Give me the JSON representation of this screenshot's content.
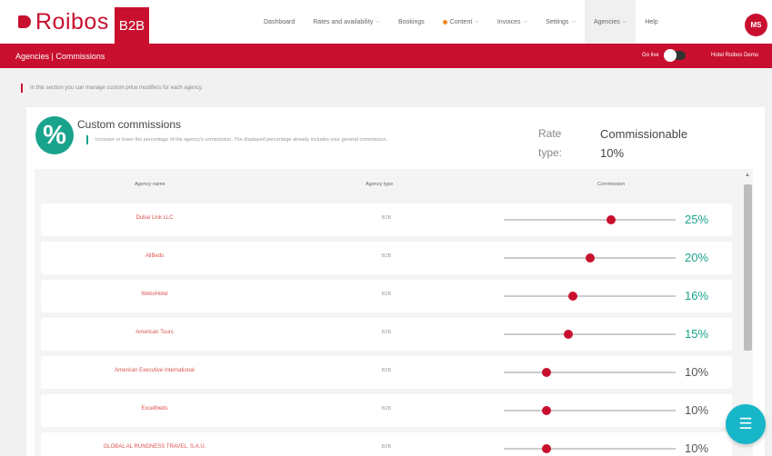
{
  "app": {
    "logo_text": "Roibos",
    "logo_badge": "B2B"
  },
  "nav": {
    "items": [
      {
        "label": "Dashboard",
        "chevron": false,
        "dot": false
      },
      {
        "label": "Rates and availability",
        "chevron": true,
        "dot": false
      },
      {
        "label": "Bookings",
        "chevron": false,
        "dot": false
      },
      {
        "label": "Content",
        "chevron": true,
        "dot": true
      },
      {
        "label": "Invoices",
        "chevron": true,
        "dot": false
      },
      {
        "label": "Settings",
        "chevron": true,
        "dot": false
      },
      {
        "label": "Agencies",
        "chevron": true,
        "dot": false,
        "active": true
      },
      {
        "label": "Help",
        "chevron": false,
        "dot": false
      }
    ],
    "avatar_initials": "MS"
  },
  "subheader": {
    "breadcrumb": "Agencies | Commissions",
    "go_live_label": "Go live",
    "hotel_label": "Hotel Roibos Demo"
  },
  "info_text": "In this section you can manage custom price modifiers for each agency.",
  "card": {
    "title": "Custom commissions",
    "description": "Increase or lower the percentage of the agency's commission. The displayed percentage already includes your general commission.",
    "rate_type_label": "Rate type:",
    "rate_type_value": "Commissionable",
    "rate_percent": "10%"
  },
  "table": {
    "headers": [
      "Agency name",
      "Agency type",
      "Commission"
    ],
    "rows": [
      {
        "name": "Dubai Link LLC",
        "type": "B2B",
        "commission": 25,
        "display": "25%",
        "highlight": true
      },
      {
        "name": "AllBeds",
        "type": "B2B",
        "commission": 20,
        "display": "20%",
        "highlight": true
      },
      {
        "name": "WebsHotel",
        "type": "B2B",
        "commission": 16,
        "display": "16%",
        "highlight": true
      },
      {
        "name": "American Tours",
        "type": "B2B",
        "commission": 15,
        "display": "15%",
        "highlight": true
      },
      {
        "name": "American Executive International",
        "type": "B2B",
        "commission": 10,
        "display": "10%",
        "highlight": false
      },
      {
        "name": "Excellbeds",
        "type": "B2B",
        "commission": 10,
        "display": "10%",
        "highlight": false
      },
      {
        "name": "GLOBAL AL RUNDNESS TRAVEL, S.A.U.",
        "type": "B2B",
        "commission": 10,
        "display": "10%",
        "highlight": false
      }
    ]
  },
  "colors": {
    "brand": "#c8102e",
    "teal": "#1aa38c",
    "fab": "#17b6c8"
  },
  "icons": {
    "percent": "percent-icon",
    "fab": "list-icon"
  }
}
